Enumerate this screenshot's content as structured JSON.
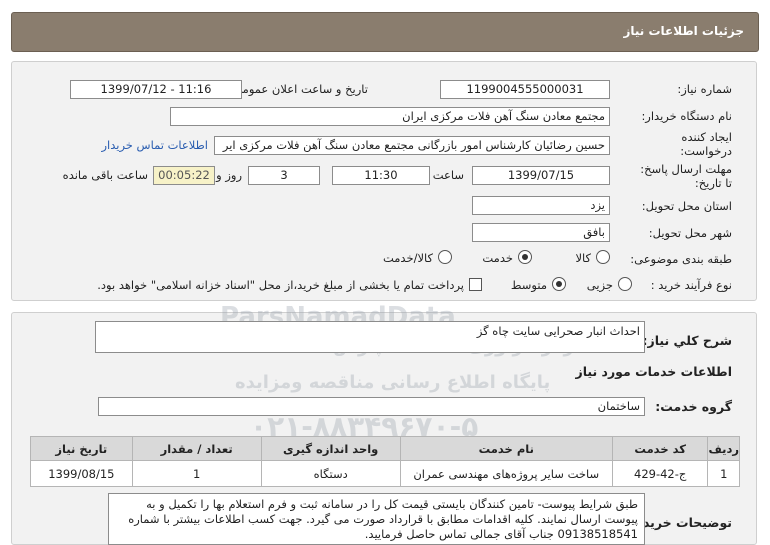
{
  "page_title": "جزئیات اطلاعات نیاز",
  "fields": {
    "need_number_label": "شماره نیاز:",
    "need_number": "1199004555000031",
    "announce_label": "تاریخ و ساعت اعلان عمومی:",
    "announce_value": "1399/07/12 - 11:16",
    "buyer_label": "نام دستگاه خریدار:",
    "buyer_value": "مجتمع معادن سنگ آهن فلات مرکزی ایران",
    "creator_label_1": "ایجاد کننده",
    "creator_label_2": "درخواست:",
    "creator_value": "حسین رضائیان کارشناس امور بازرگانی مجتمع معادن سنگ آهن فلات مرکزی ایر",
    "contact_link": "اطلاعات تماس خریدار",
    "deadline_label_1": "مهلت ارسال پاسخ:",
    "deadline_label_2": "تا تاریخ:",
    "deadline_date": "1399/07/15",
    "time_label": "ساعت",
    "deadline_time": "11:30",
    "days_value": "3",
    "days_label": "روز و",
    "remaining_time": "00:05:22",
    "remaining_label": "ساعت باقی مانده",
    "province_label": "استان محل تحویل:",
    "province_value": "یزد",
    "city_label": "شهر محل تحویل:",
    "city_value": "بافق",
    "category_label": "طبقه بندی موضوعی:",
    "category_options": [
      "کالا",
      "خدمت",
      "کالا/خدمت"
    ],
    "category_selected": "خدمت",
    "process_label": "نوع فرآیند خرید :",
    "process_options": [
      "جزیی",
      "متوسط"
    ],
    "process_selected": "متوسط",
    "payment_note": "پرداخت تمام یا بخشی از مبلغ خرید،از محل \"اسناد خزانه اسلامی\" خواهد بود."
  },
  "summary": {
    "label": "شرح کلي نياز:",
    "value": "احداث انبار صحرایی سایت چاه گز"
  },
  "services_info_title": "اطلاعات خدمات مورد نیاز",
  "service_group": {
    "label": "گروه خدمت:",
    "value": "ساختمان"
  },
  "table": {
    "headers": [
      "ردیف",
      "کد خدمت",
      "نام خدمت",
      "واحد اندازه گیری",
      "تعداد / مقدار",
      "تاریخ نیاز"
    ],
    "rows": [
      [
        "1",
        "ج-42-429",
        "ساخت سایر پروژه‌های مهندسی عمران",
        "دستگاه",
        "1",
        "1399/08/15"
      ]
    ]
  },
  "buyer_notes": {
    "label": "توضیحات خریدار:",
    "value": "طبق شرایط پیوست- تامین کنندگان بایستی قیمت کل را در سامانه ثبت و فرم استعلام بها را تکمیل و به پیوست ارسال نمایند. کلیه اقدامات مطابق با قرارداد صورت می گیرد. جهت کسب اطلاعات بیشتر با شماره 09138518541 جناب آقای جمالی تماس حاصل فرمایید."
  },
  "watermark": {
    "line1": "ParsNamadData",
    "line2": "مرکز فراوری اطلاعات پارس نماد داده ها",
    "line3": "پایگاه اطلاع رسانی مناقصه ومزایده",
    "line4": "۰۲۱-۸۸۳۴۹۶۷۰-۵"
  }
}
